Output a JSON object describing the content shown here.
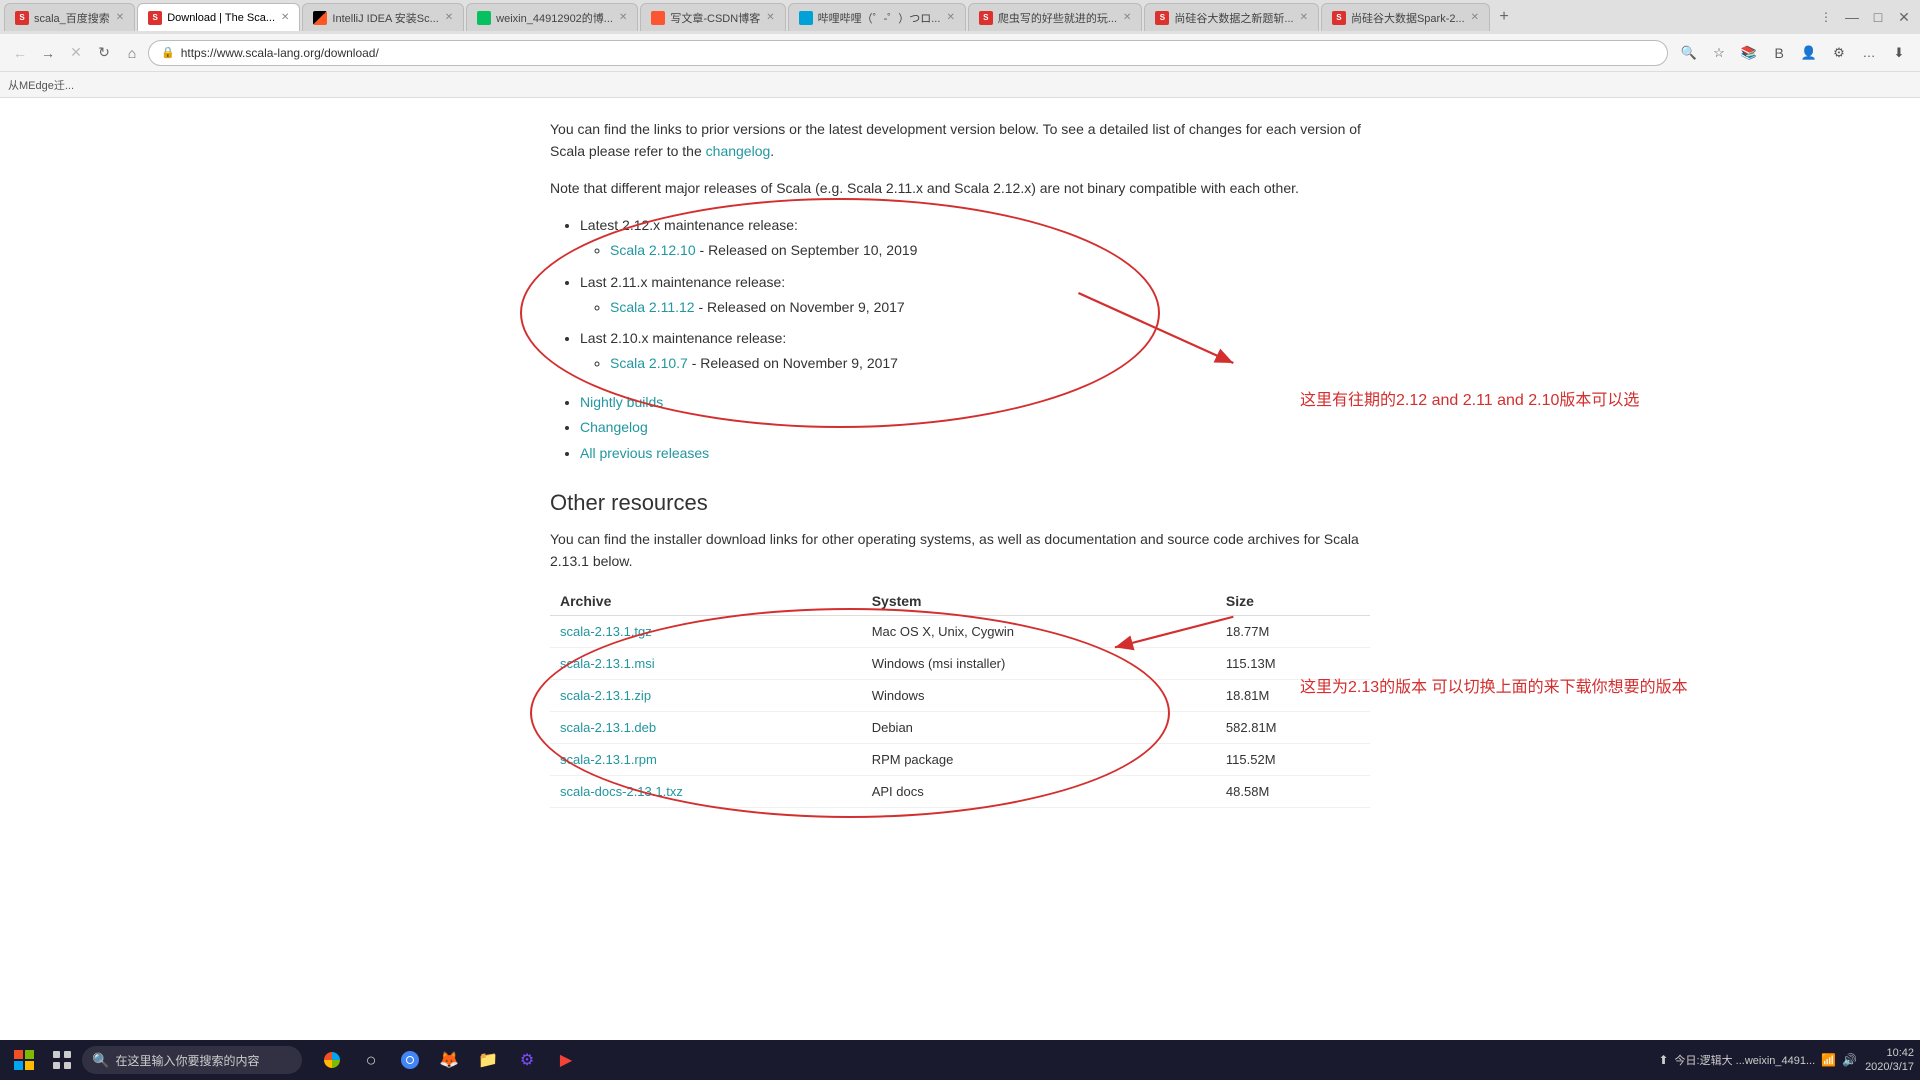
{
  "browser": {
    "tabs": [
      {
        "id": "tab1",
        "label": "scala_百度搜索",
        "favicon_type": "favicon-scala",
        "active": false
      },
      {
        "id": "tab2",
        "label": "Download | The Sca...",
        "favicon_type": "favicon-scala",
        "active": true
      },
      {
        "id": "tab3",
        "label": "IntelliJ IDEA 安装Sc...",
        "favicon_type": "favicon-idea",
        "active": false
      },
      {
        "id": "tab4",
        "label": "weixin_44912902的博...",
        "favicon_type": "favicon-wx",
        "active": false
      },
      {
        "id": "tab5",
        "label": "写文章-CSDN博客",
        "favicon_type": "favicon-csdn",
        "active": false
      },
      {
        "id": "tab6",
        "label": "哔哩哔哩（゜-゜）つロ...",
        "favicon_type": "favicon-bili",
        "active": false
      },
      {
        "id": "tab7",
        "label": "爬虫写的好些就进的玩...",
        "favicon_type": "favicon-scala",
        "active": false
      },
      {
        "id": "tab8",
        "label": "尚硅谷大数据之新题斩...",
        "favicon_type": "favicon-scala",
        "active": false
      },
      {
        "id": "tab9",
        "label": "尚硅谷大数据Spark-2...",
        "favicon_type": "favicon-scala",
        "active": false
      }
    ],
    "address": "https://www.scala-lang.org/download/",
    "address_display": "https://www.scala-lang.org/download/",
    "bookmarks_item": "从MEdge迁..."
  },
  "page": {
    "intro_para1": "You can find the links to prior versions or the latest development version below. To see a detailed list of changes for each version of Scala please refer to the",
    "changelog_link": "changelog",
    "intro_para1_end": ".",
    "intro_para2": "Note that different major releases of Scala (e.g. Scala 2.11.x and Scala 2.12.x) are not binary compatible with each other.",
    "bullet_items": [
      {
        "label": "Latest 2.12.x maintenance release:",
        "sub_items": [
          {
            "link": "Scala 2.12.10",
            "text": " - Released on September 10, 2019"
          }
        ]
      },
      {
        "label": "Last 2.11.x maintenance release:",
        "sub_items": [
          {
            "link": "Scala 2.11.12",
            "text": " - Released on November 9, 2017"
          }
        ]
      },
      {
        "label": "Last 2.10.x maintenance release:",
        "sub_items": [
          {
            "link": "Scala 2.10.7",
            "text": " - Released on November 9, 2017"
          }
        ]
      }
    ],
    "link_items": [
      {
        "link": "Nightly builds"
      },
      {
        "link": "Changelog"
      },
      {
        "link": "All previous releases"
      }
    ],
    "other_resources_title": "Other resources",
    "other_resources_para": "You can find the installer download links for other operating systems, as well as documentation and source code archives for Scala 2.13.1 below.",
    "table": {
      "headers": [
        "Archive",
        "System",
        "Size"
      ],
      "rows": [
        {
          "archive": "scala-2.13.1.tgz",
          "system": "Mac OS X, Unix, Cygwin",
          "size": "18.77M"
        },
        {
          "archive": "scala-2.13.1.msi",
          "system": "Windows (msi installer)",
          "size": "115.13M"
        },
        {
          "archive": "scala-2.13.1.zip",
          "system": "Windows",
          "size": "18.81M"
        },
        {
          "archive": "scala-2.13.1.deb",
          "system": "Debian",
          "size": "582.81M"
        },
        {
          "archive": "scala-2.13.1.rpm",
          "system": "RPM package",
          "size": "115.52M"
        },
        {
          "archive": "scala-docs-2.13.1.txz",
          "system": "API docs",
          "size": "48.58M"
        }
      ]
    }
  },
  "annotations": {
    "top_text": "这里有往期的2.12 and 2.11 and 2.10版本可以选",
    "bottom_text": "这里为2.13的版本 可以切换上面的来下载你想要的版本"
  },
  "taskbar": {
    "search_placeholder": "在这里输入你要搜索的内容",
    "clock_time": "10:42",
    "clock_date": "2020/3/17",
    "notification_text": "今日:逻辑大 ...weixin_4491..."
  }
}
